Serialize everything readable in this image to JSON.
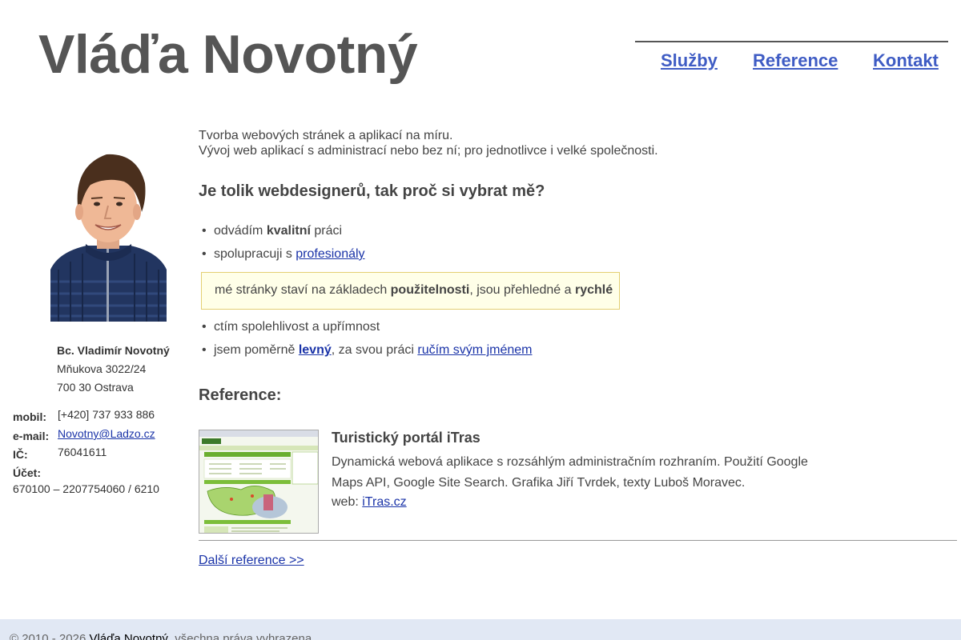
{
  "header": {
    "title": "Vláďa Novotný"
  },
  "nav": {
    "items": [
      "Služby",
      "Reference",
      "Kontakt"
    ]
  },
  "contact": {
    "name": "Bc. Vladimír Novotný",
    "street": "Mňukova 3022/24",
    "city": "700 30 Ostrava",
    "mobile_label": "mobil:",
    "mobile": "[+420] 737 933 886",
    "email_label": "e-mail:",
    "email": "Novotny@Ladzo.cz",
    "ic_label": "IČ:",
    "ic": "76041611",
    "account_label": "Účet:",
    "account": "670100 – 2207754060 / 6210"
  },
  "intro": {
    "line1": "Tvorba webových stránek a aplikací na míru.",
    "line2": "Vývoj web aplikací s administrací nebo bez ní; pro jednotlivce i velké společnosti."
  },
  "why": {
    "heading": "Je tolik webdesignerů, tak proč si vybrat mě?",
    "b1_pre": "odvádím ",
    "b1_bold": "kvalitní",
    "b1_post": " práci",
    "b2_pre": "spolupracuji s ",
    "b2_link": "profesionály",
    "hl_pre": "mé stránky staví na základech ",
    "hl_bold1": "použitelnosti",
    "hl_mid": ", jsou přehledné a ",
    "hl_bold2": "rychlé",
    "b3": "ctím spolehlivost a upřímnost",
    "b4_pre": "jsem poměrně ",
    "b4_link1": "levný",
    "b4_mid": ", za svou práci ",
    "b4_link2": "ručím svým jménem"
  },
  "references": {
    "heading": "Reference:",
    "item_title": "Turistický portál iTras",
    "item_desc": "Dynamická webová aplikace s rozsáhlým administračním rozhraním. Použití Google Maps API, Google Site Search. Grafika Jiří Tvrdek, texty Luboš Moravec.",
    "web_label": "web: ",
    "web_link": "iTras.cz",
    "more": "Další reference >>"
  },
  "footer": {
    "pre": "© 2010 - 2026 ",
    "link": "Vláďa Novotný",
    "post": ", všechna práva vyhrazena"
  },
  "colors": {
    "nav_link": "#3f5cc4",
    "link": "#1a33a8",
    "highlight_bg": "#ffffe8",
    "highlight_border": "#e3cf72",
    "footer_bg": "#e1e8f4"
  }
}
